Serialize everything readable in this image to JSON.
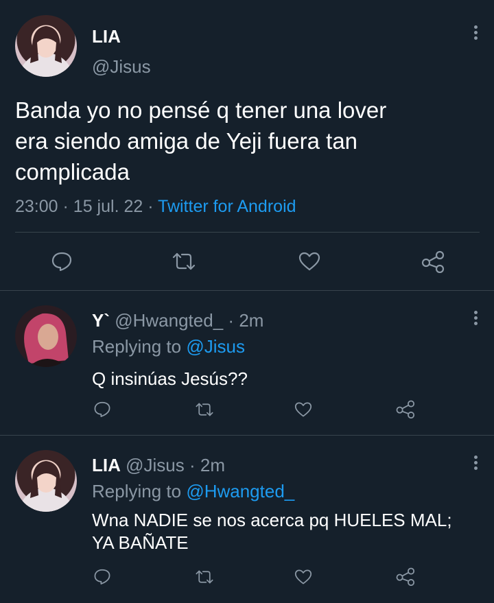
{
  "main_tweet": {
    "display_name": "LIA",
    "handle": "@Jisus",
    "text_lines": [
      "Banda yo no pensé q tener una lover",
      "era siendo amiga de Yeji fuera tan",
      "complicada"
    ],
    "time": "23:00",
    "sep1": "·",
    "date": "15 jul. 22",
    "sep2": "·",
    "client": "Twitter for Android"
  },
  "replies": [
    {
      "display_name": "Y`",
      "handle": "@Hwangted_",
      "sep": "·",
      "age": "2m",
      "replying_label": "Replying to",
      "replying_handle": "@Jisus",
      "text_lines": [
        "Q insinúas Jesús??"
      ]
    },
    {
      "display_name": "LIA",
      "handle": "@Jisus",
      "sep": "·",
      "age": "2m",
      "replying_label": "Replying to",
      "replying_handle": "@Hwangted_",
      "text_lines": [
        "Wna NADIE se nos acerca pq HUELES MAL;",
        "YA BAÑATE"
      ]
    }
  ],
  "colors": {
    "background": "#15202b",
    "text": "#ffffff",
    "muted": "#8b98a5",
    "link": "#1d9bf0",
    "divider": "#38444d"
  },
  "icons": [
    "more-options-icon",
    "reply-icon",
    "retweet-icon",
    "like-icon",
    "share-icon"
  ]
}
